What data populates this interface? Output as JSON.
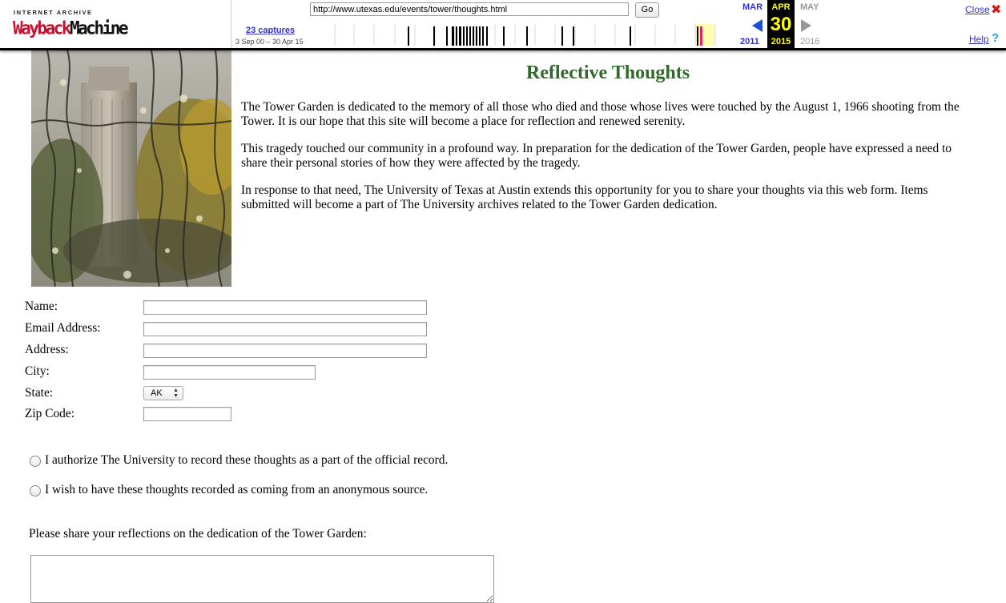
{
  "wayback": {
    "logo_top": "INTERNET ARCHIVE",
    "logo_word_a": "Wayback",
    "logo_word_b": "Machine",
    "url": "http://www.utexas.edu/events/tower/thoughts.html",
    "go_label": "Go",
    "captures": "23 captures",
    "range": "3 Sep 00 – 30 Apr 15",
    "prev_month": "MAR",
    "current_month": "APR",
    "next_month": "MAY",
    "current_day": "30",
    "prev_year": "2011",
    "current_year": "2015",
    "next_year": "2016",
    "close_label": "Close",
    "help_label": "Help",
    "colors": {
      "link": "#3333cc",
      "current_bg": "#000000",
      "current_fg": "#ffff00",
      "logo_red": "#c8102e"
    }
  },
  "page": {
    "heading": "Reflective Thoughts",
    "heading_color": "#2f6b28",
    "paragraphs": [
      "The Tower Garden is dedicated to the memory of all those who died and those whose lives were touched by the August 1, 1966 shooting from the Tower. It is our hope that this site will become a place for reflection and renewed serenity.",
      "This tragedy touched our community in a profound way. In preparation for the dedication of the Tower Garden, people have expressed a need to share their personal stories of how they were affected by the tragedy.",
      "In response to that need, The University of Texas at Austin extends this opportunity for you to share your thoughts via this web form. Items submitted will become a part of The University archives related to the Tower Garden dedication."
    ]
  },
  "form": {
    "name_label": "Name:",
    "email_label": "Email Address:",
    "address_label": "Address:",
    "city_label": "City:",
    "state_label": "State:",
    "state_value": "AK",
    "zip_label": "Zip Code:",
    "name_value": "",
    "email_value": "",
    "address_value": "",
    "city_value": "",
    "zip_value": "",
    "radio_authorize": "I authorize The University to record these thoughts as a part of the official record.",
    "radio_anonymous": "I wish to have these thoughts recorded as coming from an anonymous source.",
    "reflect_prompt": "Please share your reflections on the dedication of the Tower Garden:",
    "reflect_value": ""
  }
}
